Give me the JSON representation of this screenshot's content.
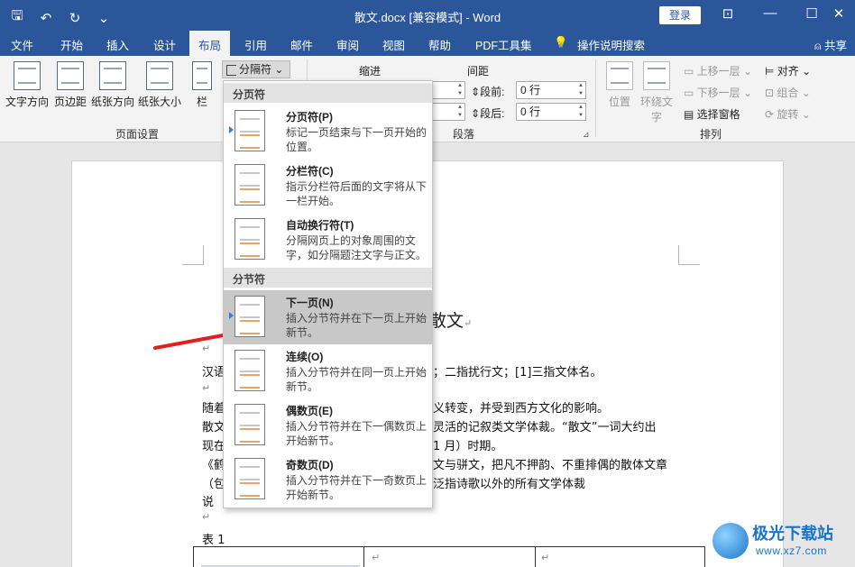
{
  "titlebar": {
    "title": "散文.docx [兼容模式] - Word",
    "login": "登录",
    "qat": {
      "save": "🖫",
      "undo": "↶",
      "redo": "↻",
      "more": "⌄"
    },
    "controls": {
      "ribbon_display": "⊡",
      "minimize": "—",
      "maximize": "☐",
      "close": "✕"
    }
  },
  "tabs": [
    "文件",
    "开始",
    "插入",
    "设计",
    "布局",
    "引用",
    "邮件",
    "审阅",
    "视图",
    "帮助",
    "PDF工具集",
    "操作说明搜索"
  ],
  "active_tab": "布局",
  "share": "共享",
  "ribbon": {
    "page_setup": {
      "buttons": [
        "文字方向",
        "页边距",
        "纸张方向",
        "纸张大小",
        "栏"
      ],
      "breaks_button": "分隔符",
      "label": "页面设置"
    },
    "paragraph": {
      "indent_label": "缩进",
      "spacing_label": "间距",
      "before_label": "段前:",
      "before_value": "0 行",
      "after_label": "段后:",
      "after_value": "0 行",
      "label": "段落"
    },
    "arrange": {
      "position": "位置",
      "wrap_text": "环绕文字",
      "bring_forward": "上移一层",
      "send_backward": "下移一层",
      "selection_pane": "选择窗格",
      "align": "对齐",
      "group": "组合",
      "rotate": "旋转",
      "label": "排列"
    }
  },
  "menu": {
    "page_breaks_header": "分页符",
    "section_breaks_header": "分节符",
    "items": [
      {
        "title": "分页符(P)",
        "desc": "标记一页结束与下一页开始的位置。"
      },
      {
        "title": "分栏符(C)",
        "desc": "指示分栏符后面的文字将从下一栏开始。"
      },
      {
        "title": "自动换行符(T)",
        "desc": "分隔网页上的对象周围的文字，如分隔题注文字与正文。"
      },
      {
        "title": "下一页(N)",
        "desc": "插入分节符并在下一页上开始新节。"
      },
      {
        "title": "连续(O)",
        "desc": "插入分节符并在同一页上开始新节。"
      },
      {
        "title": "偶数页(E)",
        "desc": "插入分节符并在下一偶数页上开始新节。"
      },
      {
        "title": "奇数页(D)",
        "desc": "插入分节符并在下一奇数页上开始新节。"
      }
    ],
    "highlighted": "下一页(N)"
  },
  "document": {
    "title_fragment": "散文",
    "lines": [
      "汉语",
      "；二指扰行文；[1]三指文体名。",
      "随着",
      "义转变，并受到西方文化的影响。",
      "散文",
      "灵活的记叙类文学体裁。“散文”一词大约出",
      "现在",
      "1 月）时期。",
      "《鹤",
      "文与骈文，把凡不押韵、不重排偶的散体文章",
      "（包",
      "泛指诗歌以外的所有文学体裁",
      "说",
      "表 1"
    ],
    "paragraph_mark": "↵"
  },
  "watermark": {
    "brand": "极光下载站",
    "url": "www.xz7.com"
  },
  "colors": {
    "accent": "#2b579a",
    "highlight": "#c8c8c8",
    "arrow": "#e02020"
  }
}
